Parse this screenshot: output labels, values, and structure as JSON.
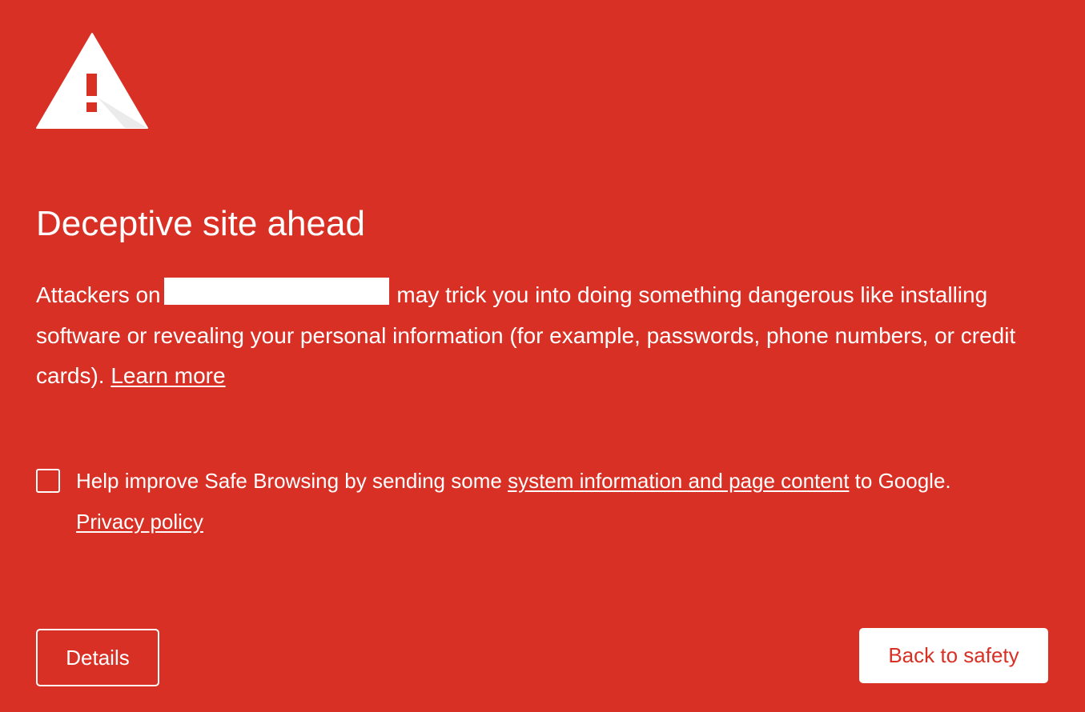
{
  "theme": {
    "background": "#d93025",
    "foreground": "#ffffff",
    "icon_mark": "#d93025"
  },
  "warning": {
    "icon": "warning-triangle-icon",
    "heading": "Deceptive site ahead",
    "message_prefix": "Attackers on",
    "message_suffix": "may trick you into doing something dangerous like installing software or revealing your personal information (for example, passwords, phone numbers, or credit cards).",
    "learn_more_link": "Learn more"
  },
  "safe_browsing_optin": {
    "checked": false,
    "text_prefix": "Help improve Safe Browsing by sending some",
    "system_info_link": "system information and page content",
    "text_suffix": "to Google.",
    "privacy_policy_link": "Privacy policy"
  },
  "buttons": {
    "details": "Details",
    "back_to_safety": "Back to safety"
  }
}
